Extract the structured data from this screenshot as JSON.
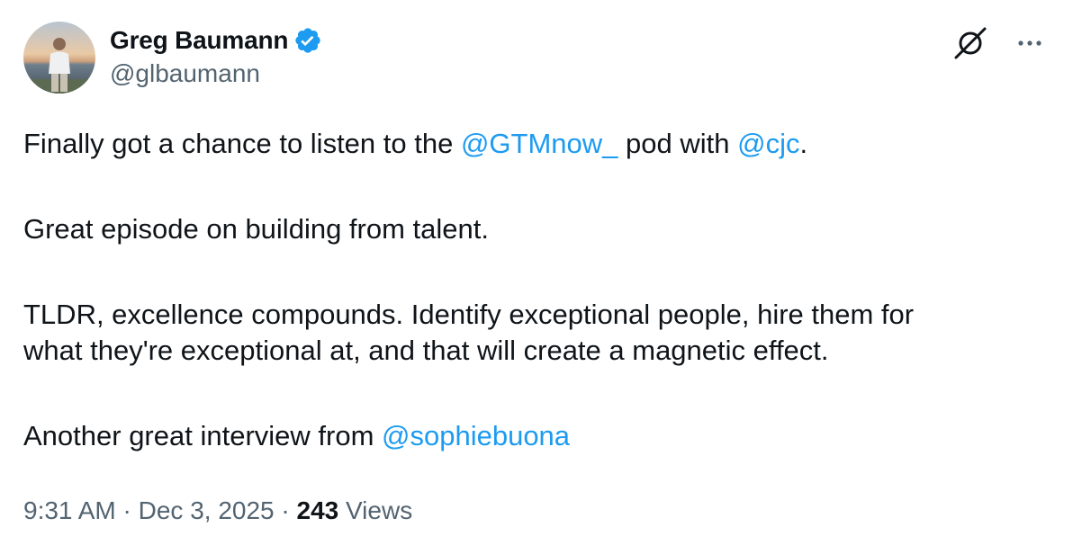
{
  "author": {
    "display_name": "Greg Baumann",
    "handle": "@glbaumann",
    "verified": true,
    "avatar_description": "man standing by water at sunset"
  },
  "icons": {
    "verified": "verified-badge-icon",
    "grok": "grok-icon",
    "more": "more-options-icon"
  },
  "colors": {
    "mention": "#1d9bf0",
    "verified_badge": "#1d9bf0",
    "secondary_text": "#536471",
    "primary_text": "#0f1419"
  },
  "tweet": {
    "p1": {
      "t1": "Finally got a chance to listen to the ",
      "m1": "@GTMnow_",
      "t2": " pod with ",
      "m2": "@cjc",
      "t3": "."
    },
    "p2": "Great episode on building from talent.",
    "p3_line1": "TLDR, excellence compounds. Identify exceptional people, hire them for",
    "p3_line2": "what they're exceptional at, and that will create a magnetic effect.",
    "p4": {
      "t1": "Another great interview from ",
      "m1": "@sophiebuona"
    }
  },
  "meta": {
    "time": "9:31 AM",
    "separator": " · ",
    "date": "Dec 3, 2025",
    "views_count": "243",
    "views_label": "Views"
  }
}
